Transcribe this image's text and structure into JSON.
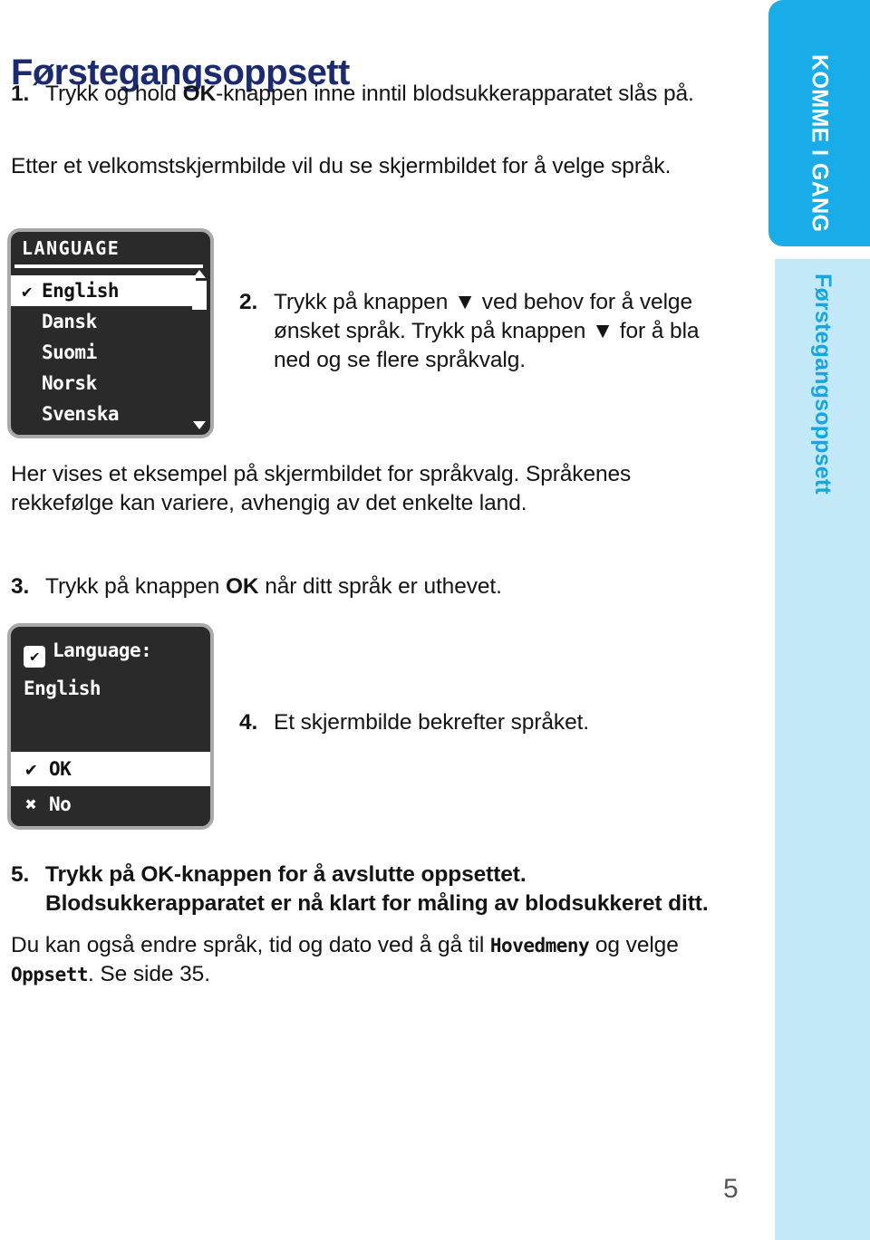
{
  "page": {
    "title": "Førstegangsoppsett",
    "number": "5"
  },
  "side_tabs": {
    "primary": "KOMME I GANG",
    "secondary": "Førstegangsoppsett"
  },
  "steps": {
    "step1": {
      "number": "1.",
      "text_before": "Trykk og hold ",
      "bold": "OK",
      "text_after": "-knappen inne inntil blodsukkerapparatet slås på."
    },
    "welcome_paragraph": "Etter et velkomstskjermbilde vil du se skjermbildet for å velge språk.",
    "step2": {
      "number": "2.",
      "text": "Trykk på knappen ▼ ved behov for å velge ønsket språk. Trykk på knappen ▼ for å bla ned og se flere språkvalg."
    },
    "example_paragraph": "Her vises et eksempel på skjermbildet for språkvalg. Språkenes rekkefølge kan variere, avhengig av det enkelte land.",
    "step3": {
      "number": "3.",
      "text_before": "Trykk på knappen ",
      "bold": "OK",
      "text_after": " når ditt språk er uthevet."
    },
    "step4": {
      "number": "4.",
      "text": "Et skjermbilde bekrefter språket."
    },
    "step5": {
      "number": "5.",
      "text": "Trykk på OK-knappen for å avslutte oppsettet. Blodsukkerapparatet er nå klart for måling av blodsukkeret ditt."
    },
    "tip_paragraph": {
      "part1": "Du kan også endre språk, tid og dato ved å gå til ",
      "lcd1": "Hovedmeny",
      "part2": " og velge ",
      "lcd2": "Oppsett",
      "part3": ". Se side 35."
    }
  },
  "lcd_language_screen": {
    "header": "LANGUAGE",
    "items": [
      {
        "label": "English",
        "selected": true,
        "check": "✔"
      },
      {
        "label": "Dansk",
        "selected": false,
        "check": ""
      },
      {
        "label": "Suomi",
        "selected": false,
        "check": ""
      },
      {
        "label": "Norsk",
        "selected": false,
        "check": ""
      },
      {
        "label": "Svenska",
        "selected": false,
        "check": ""
      }
    ],
    "scrollbar": {
      "up_arrow": "▲",
      "down_arrow": "▼"
    }
  },
  "lcd_confirm_screen": {
    "checkbox_glyph": "✔",
    "title": "Language:",
    "value": "English",
    "ok_glyph": "✔",
    "ok_label": "OK",
    "no_glyph": "✖",
    "no_label": "No"
  },
  "colors": {
    "title_navy": "#1C2B6E",
    "tab_primary": "#18ACE8",
    "tab_secondary": "#C3E8F8",
    "tab_secondary_text": "#19A5DE",
    "lcd_background": "#2A2A2A",
    "lcd_border": "#A9A9A9"
  }
}
